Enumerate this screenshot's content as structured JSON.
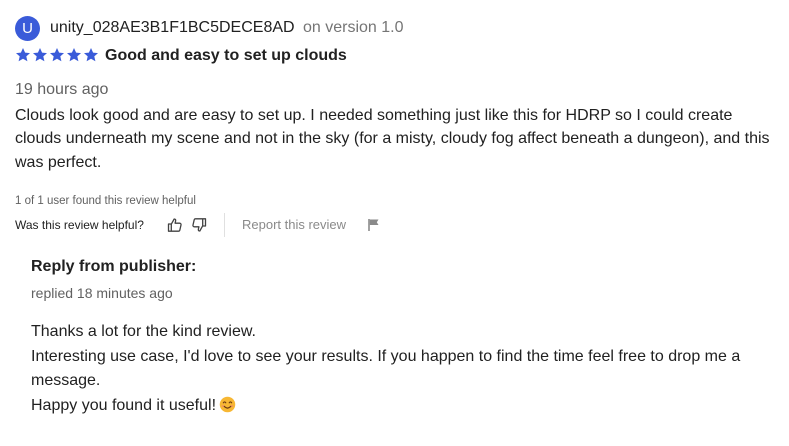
{
  "reviewer": {
    "avatar_letter": "U",
    "username": "unity_028AE3B1F1BC5DECE8AD",
    "version": "on version 1.0",
    "avatar_color": "#3a5bd9"
  },
  "review": {
    "rating": 5,
    "rating_max": 5,
    "star_color": "#3a5bd9",
    "title": "Good and easy to set up clouds",
    "time_ago": "19 hours ago",
    "body": "Clouds look good and are easy to set up. I needed something just like this for HDRP so I could create clouds underneath my scene and not in the sky (for a misty, cloudy fog affect beneath a dungeon), and this was perfect."
  },
  "helpfulness": {
    "count_text": "1 of 1 user found this review helpful",
    "question": "Was this review helpful?",
    "thumb_up_icon": "thumbs-up-icon",
    "thumb_down_icon": "thumbs-down-icon",
    "report_label": "Report this review",
    "report_icon": "flag-icon"
  },
  "reply": {
    "heading": "Reply from publisher:",
    "time": "replied 18 minutes ago",
    "lines": [
      "Thanks a lot for the kind review.",
      "Interesting use case, I'd love to see your results. If you happen to find the time feel free to drop me a message.",
      "Happy you found it useful!"
    ],
    "emoji_icon": "smiling-face-icon"
  }
}
